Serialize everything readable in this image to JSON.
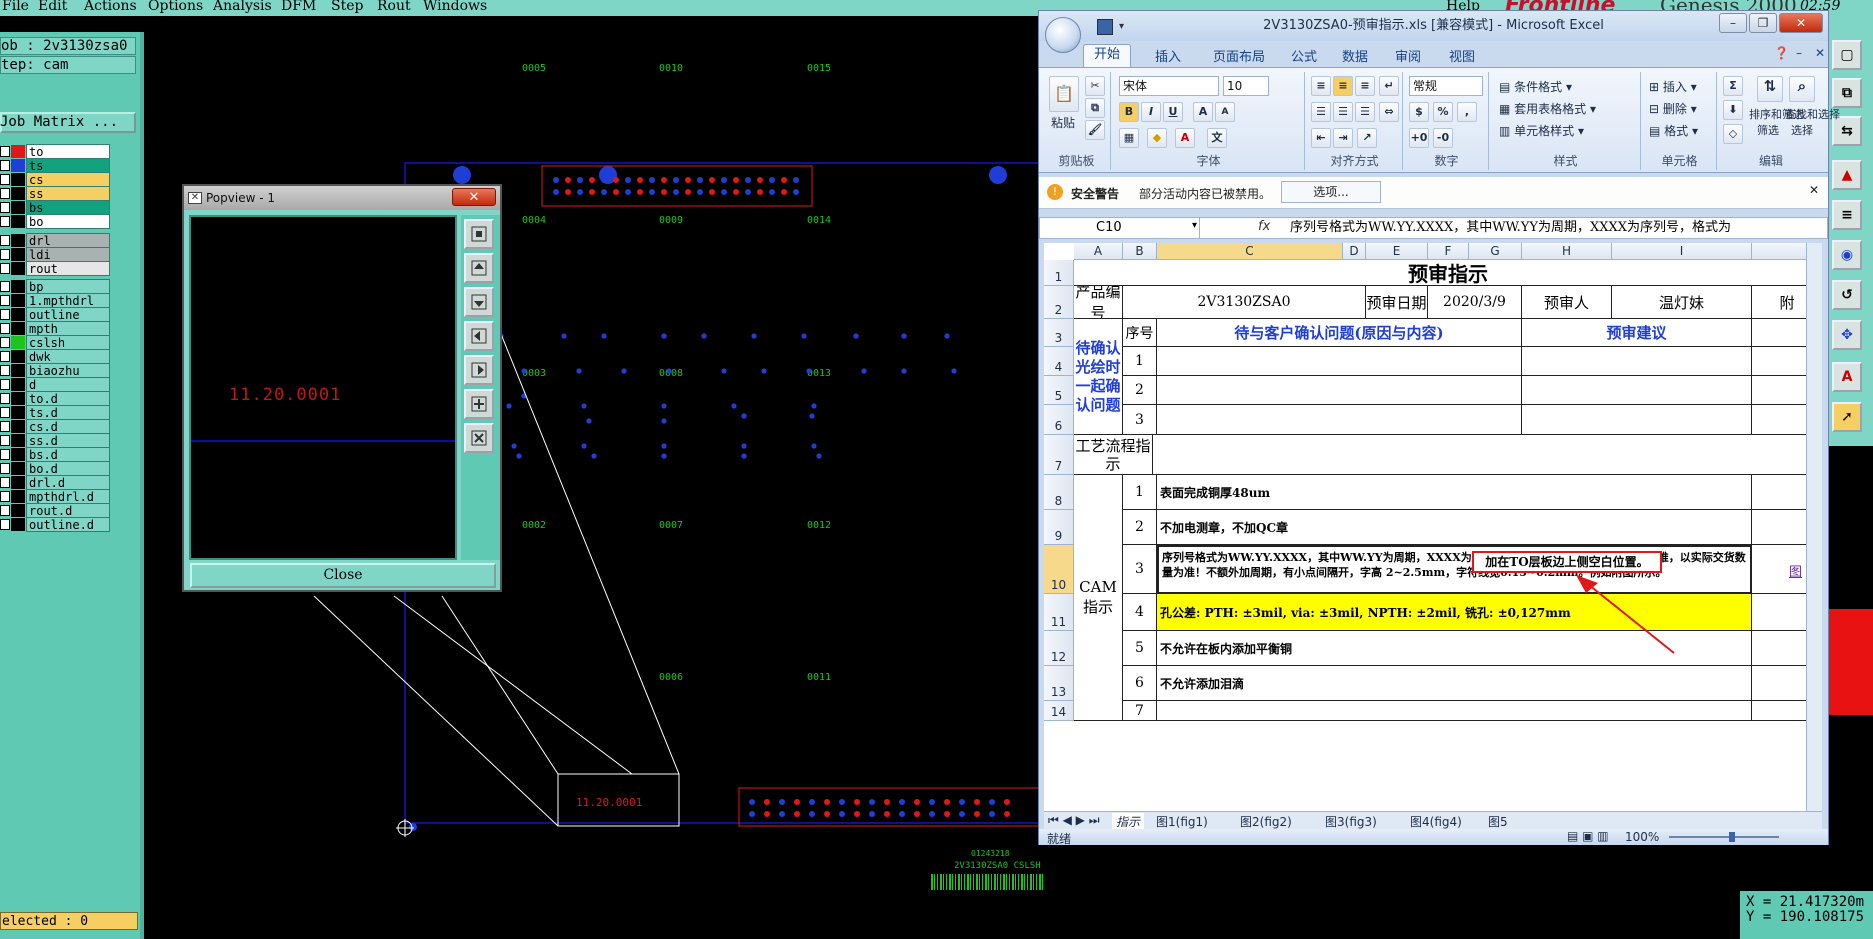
{
  "genesis": {
    "menu": [
      "File",
      "Edit",
      "Actions",
      "Options",
      "Analysis",
      "DFM",
      "Step",
      "Rout",
      "Windows"
    ],
    "help": "Help",
    "brand": "Frontline",
    "product": "Genesis 2000",
    "time": "02:59",
    "job": "ob : 2v3130zsa0",
    "step": "tep: cam",
    "job_matrix": "Job Matrix ...",
    "layers": [
      {
        "name": "to",
        "color": "#e01818",
        "bg": "#ffffff"
      },
      {
        "name": "ts",
        "color": "#1f3ed6",
        "bg": "#13a27f"
      },
      {
        "name": "cs",
        "color": "#000000",
        "bg": "#f5cf61"
      },
      {
        "name": "ss",
        "color": "#000000",
        "bg": "#f5cf61"
      },
      {
        "name": "bs",
        "color": "#000000",
        "bg": "#13a27f"
      },
      {
        "name": "bo",
        "color": "#000000",
        "bg": "#ffffff"
      },
      {
        "name": "drl",
        "color": "#000000",
        "bg": "#a8b2b0"
      },
      {
        "name": "ldi",
        "color": "#000000",
        "bg": "#a8b2b0"
      },
      {
        "name": "rout",
        "color": "#000000",
        "bg": "#e6e6e6"
      },
      {
        "name": "bp",
        "color": "#000000",
        "bg": "#7fd6c7"
      },
      {
        "name": "1.mpthdrl",
        "color": "#000000",
        "bg": "#7fd6c7"
      },
      {
        "name": "outline",
        "color": "#000000",
        "bg": "#7fd6c7"
      },
      {
        "name": "mpth",
        "color": "#000000",
        "bg": "#7fd6c7"
      },
      {
        "name": "cslsh",
        "color": "#1ec41e",
        "bg": "#7fd6c7"
      },
      {
        "name": "dwk",
        "color": "#000000",
        "bg": "#7fd6c7"
      },
      {
        "name": "biaozhu",
        "color": "#000000",
        "bg": "#7fd6c7"
      },
      {
        "name": "d",
        "color": "#000000",
        "bg": "#7fd6c7"
      },
      {
        "name": "to.d",
        "color": "#000000",
        "bg": "#7fd6c7"
      },
      {
        "name": "ts.d",
        "color": "#000000",
        "bg": "#7fd6c7"
      },
      {
        "name": "cs.d",
        "color": "#000000",
        "bg": "#7fd6c7"
      },
      {
        "name": "ss.d",
        "color": "#000000",
        "bg": "#7fd6c7"
      },
      {
        "name": "bs.d",
        "color": "#000000",
        "bg": "#7fd6c7"
      },
      {
        "name": "bo.d",
        "color": "#000000",
        "bg": "#7fd6c7"
      },
      {
        "name": "drl.d",
        "color": "#000000",
        "bg": "#7fd6c7"
      },
      {
        "name": "mpthdrl.d",
        "color": "#000000",
        "bg": "#7fd6c7"
      },
      {
        "name": "rout.d",
        "color": "#000000",
        "bg": "#7fd6c7"
      },
      {
        "name": "outline.d",
        "color": "#000000",
        "bg": "#7fd6c7"
      }
    ],
    "selected": "elected : 0",
    "coord_x": "X = 21.417320m",
    "coord_y": "Y = 190.108175",
    "canvas_labels": [
      "0005",
      "0010",
      "0015",
      "0004",
      "0009",
      "0014",
      "0003",
      "0008",
      "0013",
      "0002",
      "0007",
      "0012",
      "0006",
      "0011"
    ],
    "canvas_marks": {
      "code_text": "11.20.0001",
      "board_text": "2V3130ZSA0 CSLSH",
      "small_text": "01243218"
    }
  },
  "popview": {
    "title": "Popview - 1",
    "close_label": "Close",
    "close_x": "✕",
    "view_text": "11.20.0001"
  },
  "excel": {
    "title": "2V3130ZSA0-预审指示.xls [兼容模式] - Microsoft Excel",
    "tabs": [
      "开始",
      "插入",
      "页面布局",
      "公式",
      "数据",
      "审阅",
      "视图"
    ],
    "ribbon": {
      "paste": "粘贴",
      "font_name": "宋体",
      "font_size": "10",
      "number_format": "常规",
      "groups": [
        "剪贴板",
        "字体",
        "对齐方式",
        "数字",
        "样式",
        "单元格",
        "编辑"
      ],
      "styles": [
        "条件格式",
        "套用表格格式",
        "单元格样式"
      ],
      "cells": [
        "插入",
        "删除",
        "格式"
      ],
      "edit": [
        "排序和筛选",
        "查找和选择"
      ],
      "edit_sub": [
        "筛选",
        "选择"
      ]
    },
    "security": {
      "title": "安全警告",
      "message": "部分活动内容已被禁用。",
      "button": "选项..."
    },
    "name_box": "C10",
    "formula": "序列号格式为WW.YY.XXXX，其中WW.YY为周期，XXXX为序列号，格式为",
    "columns": [
      "A",
      "B",
      "C",
      "D",
      "E",
      "F",
      "G",
      "H",
      "I"
    ],
    "rows": [
      "1",
      "2",
      "3",
      "4",
      "5",
      "6",
      "7",
      "8",
      "9",
      "10",
      "11",
      "12",
      "13",
      "14"
    ],
    "sheet": {
      "title": "预审指示",
      "product_label": "产品编号",
      "product_value": "2V3130ZSA0",
      "review_date_label": "预审日期",
      "review_date": "2020/3/9",
      "reviewer_label": "预审人",
      "reviewer": "温灯妹",
      "attach": "附",
      "seq_header": "序号",
      "issue_header": "待与客户确认问题(原因与内容)",
      "advice_header": "预审建议",
      "pending_label": "待确认光绘时一起确认问题",
      "pending_rows": [
        "1",
        "2",
        "3"
      ],
      "process_label": "工艺流程指示",
      "cam_label": "CAM指示",
      "items": [
        {
          "n": "1",
          "text": "表面完成铜厚48um"
        },
        {
          "n": "2",
          "text": "不加电测章，不加QC章"
        },
        {
          "n": "3",
          "text": "序列号格式为WW.YY.XXXX，其中WW.YY为周期，XXXX为序列号，格式为0001.0002…以此类推，以实际交货数量为准！不额外加周期，有小点间隔开，字高 2~2.5mm，字符线宽0.15~0.2mm。例如附图所示。"
        },
        {
          "n": "4",
          "text": "孔公差: PTH: ±3mil, via: ±3mil, NPTH: ±2mil, 铣孔: ±0,127mm"
        },
        {
          "n": "5",
          "text": "不允许在板内添加平衡铜"
        },
        {
          "n": "6",
          "text": "不允许添加泪滴"
        },
        {
          "n": "7",
          "text": ""
        }
      ],
      "callout": "加在TO层板边上侧空白位置。",
      "fig_link": "图"
    },
    "sheet_tabs": [
      "指示",
      "图1(fig1)",
      "图2(fig2)",
      "图3(fig3)",
      "图4(fig4)",
      "图5"
    ],
    "status": {
      "ready": "就绪",
      "zoom": "100%"
    }
  }
}
